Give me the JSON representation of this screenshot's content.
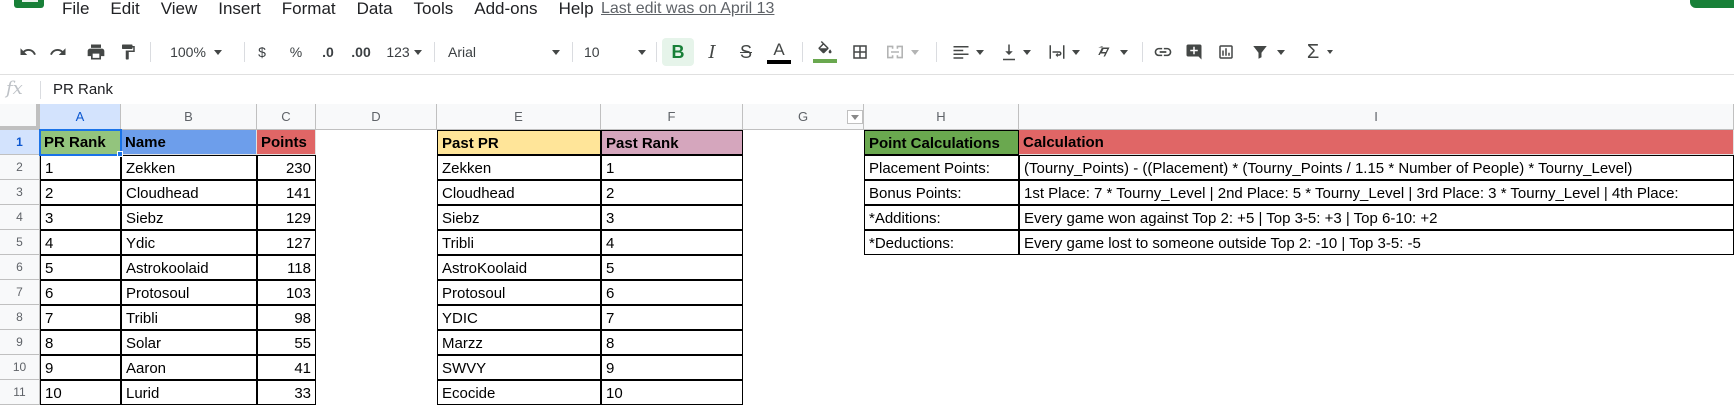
{
  "menu": {
    "items": [
      "File",
      "Edit",
      "View",
      "Insert",
      "Format",
      "Data",
      "Tools",
      "Add-ons",
      "Help"
    ],
    "last_edit": "Last edit was on April 13"
  },
  "toolbar": {
    "zoom": "100%",
    "currency": "$",
    "percent": "%",
    "decrease_decimals": ".0",
    "increase_decimals": ".00",
    "more_formats": "123",
    "font": "Arial",
    "font_size": "10",
    "bold": "B",
    "italic": "I",
    "strikethrough": "S",
    "text_color": "A",
    "text_color_swatch": "#000000",
    "fill_color_swatch": "#6aa84f",
    "functions": "Σ"
  },
  "formula_bar": {
    "fx": "fx",
    "content": "PR Rank"
  },
  "sheet": {
    "columns": [
      "A",
      "B",
      "C",
      "D",
      "E",
      "F",
      "G",
      "H",
      "I"
    ],
    "rows": [
      "1",
      "2",
      "3",
      "4",
      "5",
      "6",
      "7",
      "8",
      "9",
      "10",
      "11"
    ],
    "selected_cell": "A1",
    "header_colors": {
      "pr_rank": "#93c47d",
      "name": "#6d9eeb",
      "points": "#e06666",
      "past_pr": "#ffe599",
      "past_rank": "#d5a6bd",
      "point_calculations": "#6aa84f",
      "calculation": "#e06666"
    },
    "headers": {
      "pr_rank": "PR Rank",
      "name": "Name",
      "points": "Points",
      "past_pr": "Past PR",
      "past_rank": "Past Rank",
      "point_calculations": "Point Calculations",
      "calculation": "Calculation"
    },
    "ranking": [
      {
        "rank": "1",
        "name": "Zekken",
        "points": "230"
      },
      {
        "rank": "2",
        "name": "Cloudhead",
        "points": "141"
      },
      {
        "rank": "3",
        "name": "Siebz",
        "points": "129"
      },
      {
        "rank": "4",
        "name": "Ydic",
        "points": "127"
      },
      {
        "rank": "5",
        "name": "Astrokoolaid",
        "points": "118"
      },
      {
        "rank": "6",
        "name": "Protosoul",
        "points": "103"
      },
      {
        "rank": "7",
        "name": "Tribli",
        "points": "98"
      },
      {
        "rank": "8",
        "name": "Solar",
        "points": "55"
      },
      {
        "rank": "9",
        "name": "Aaron",
        "points": "41"
      },
      {
        "rank": "10",
        "name": "Lurid",
        "points": "33"
      }
    ],
    "past": [
      {
        "name": "Zekken",
        "rank": "1"
      },
      {
        "name": "Cloudhead",
        "rank": "2"
      },
      {
        "name": "Siebz",
        "rank": "3"
      },
      {
        "name": "Tribli",
        "rank": "4"
      },
      {
        "name": "AstroKoolaid",
        "rank": "5"
      },
      {
        "name": "Protosoul",
        "rank": "6"
      },
      {
        "name": "YDIC",
        "rank": "7"
      },
      {
        "name": "Marzz",
        "rank": "8"
      },
      {
        "name": "SWVY",
        "rank": "9"
      },
      {
        "name": "Ecocide",
        "rank": "10"
      }
    ],
    "calculations": [
      {
        "label": "Placement Points:",
        "value": "(Tourny_Points) - ((Placement) * (Tourny_Points / 1.15 * Number of People) * Tourny_Level)"
      },
      {
        "label": "Bonus Points:",
        "value": "1st Place: 7 * Tourny_Level  |  2nd Place: 5 * Tourny_Level  |  3rd Place: 3 * Tourny_Level  |  4th Place:"
      },
      {
        "label": "*Additions:",
        "value": "Every game won against Top 2: +5 | Top 3-5: +3 | Top 6-10: +2"
      },
      {
        "label": "*Deductions:",
        "value": "Every game lost to someone outside Top 2: -10 | Top 3-5: -5"
      }
    ]
  }
}
